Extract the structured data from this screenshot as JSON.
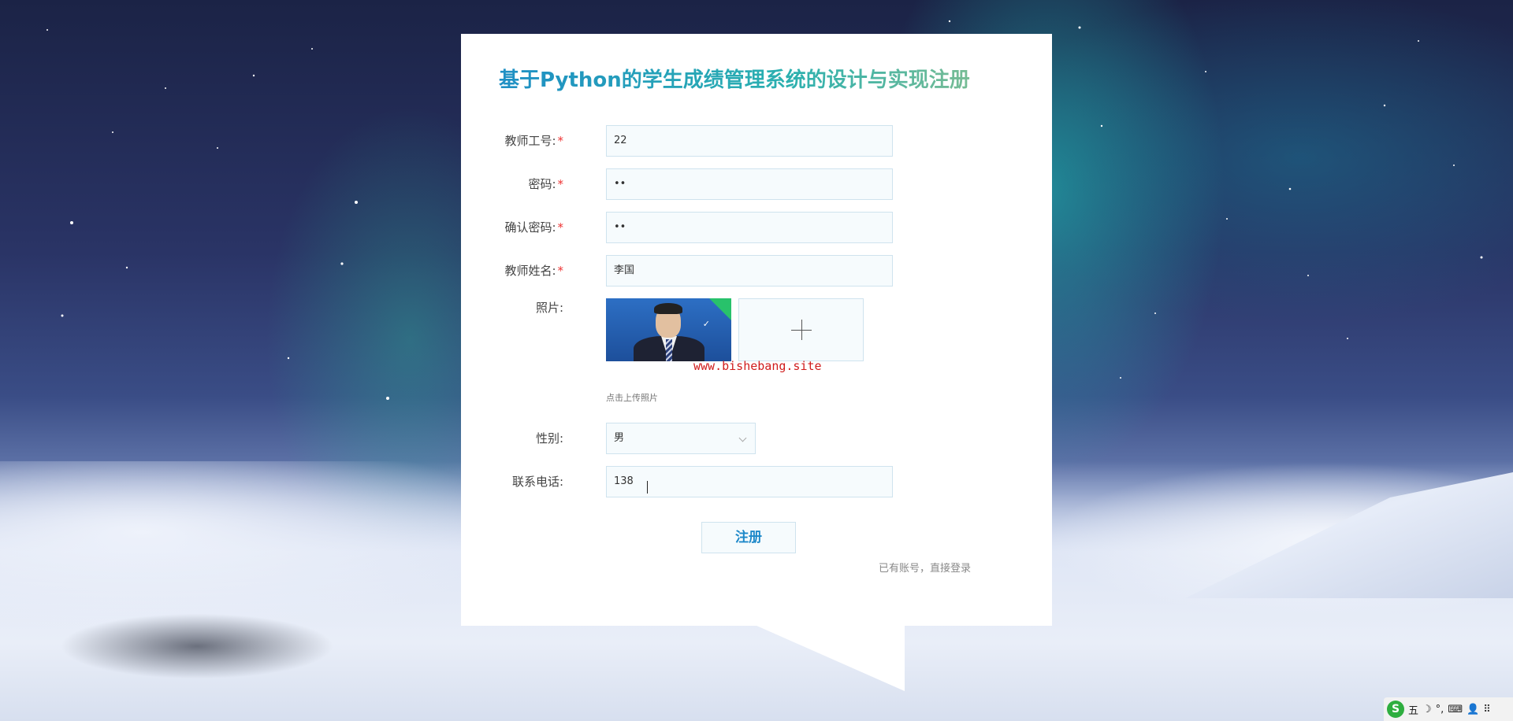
{
  "form": {
    "title": "基于Python的学生成绩管理系统的设计与实现注册",
    "fields": [
      {
        "label": "教师工号:",
        "required": "*",
        "value": "22"
      },
      {
        "label": "密码:",
        "required": "*",
        "value": "••"
      },
      {
        "label": "确认密码:",
        "required": "*",
        "value": "••"
      },
      {
        "label": "教师姓名:",
        "required": "*",
        "value": "李国"
      }
    ],
    "photo": {
      "label": "照片:",
      "hint": "点击上传照片",
      "watermark": "www.bishebang.site",
      "upload_icon": "plus-icon",
      "uploaded_status_icon": "check-icon"
    },
    "gender": {
      "label": "性别:",
      "value": "男"
    },
    "phone": {
      "label": "联系电话:",
      "value": "138"
    },
    "register_button": "注册",
    "login_link": "已有账号，直接登录"
  },
  "tray": {
    "logo": "S",
    "items": [
      "五",
      "☽",
      "°,",
      "⌨",
      "👤",
      "⠿"
    ]
  },
  "colors": {
    "title_gradient_start": "#1f8fc4",
    "title_gradient_end": "#8bbf8d",
    "required_mark": "#e33333",
    "watermark": "#d01c1c",
    "button_text": "#1d88c9"
  }
}
